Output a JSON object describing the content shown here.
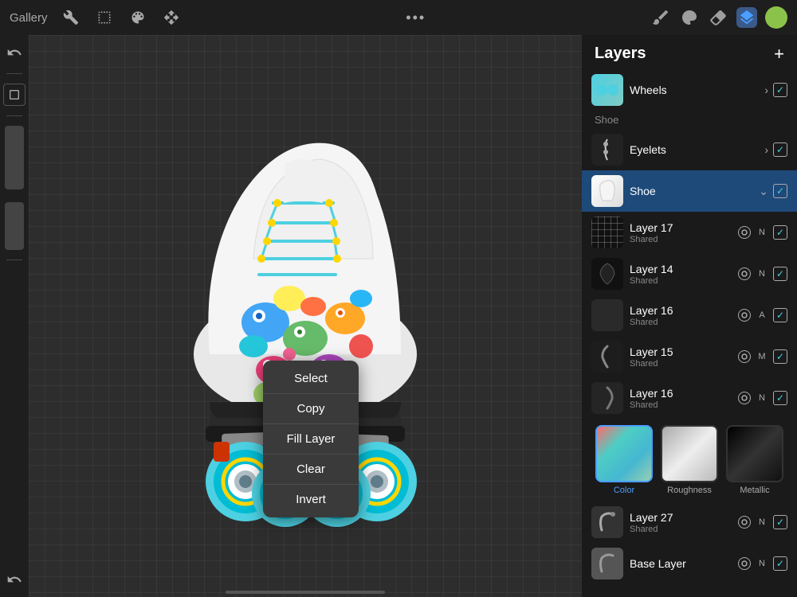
{
  "topbar": {
    "gallery_label": "Gallery",
    "center_dots": "•••",
    "tools": [
      "wrench",
      "selection",
      "stylus",
      "arrow"
    ]
  },
  "layers": {
    "title": "Layers",
    "add_label": "+",
    "items": [
      {
        "id": "wheels",
        "name": "Wheels",
        "sub": "",
        "blend": "",
        "checked": true,
        "has_chevron": true,
        "has_settings": false,
        "thumb_class": "layer-thumb-wheels"
      },
      {
        "id": "eyelets",
        "name": "Eyelets",
        "sub": "",
        "blend": "",
        "checked": true,
        "has_chevron": true,
        "has_settings": false,
        "thumb_class": "layer-thumb-eyelets"
      },
      {
        "id": "shoe",
        "name": "Shoe",
        "sub": "",
        "blend": "",
        "checked": true,
        "has_chevron": true,
        "active": true,
        "thumb_class": "layer-thumb-shoe"
      },
      {
        "id": "layer17",
        "name": "Layer 17",
        "sub": "Shared",
        "blend": "N",
        "checked": true,
        "has_chevron": false,
        "has_settings": true,
        "thumb_class": "layer-thumb-17"
      },
      {
        "id": "layer14",
        "name": "Layer 14",
        "sub": "Shared",
        "blend": "N",
        "checked": true,
        "has_chevron": false,
        "has_settings": true,
        "thumb_class": "layer-thumb-14"
      },
      {
        "id": "layer16a",
        "name": "Layer 16",
        "sub": "Shared",
        "blend": "A",
        "checked": true,
        "has_chevron": false,
        "has_settings": true,
        "thumb_class": "layer-thumb-16a"
      },
      {
        "id": "layer15",
        "name": "Layer 15",
        "sub": "Shared",
        "blend": "M",
        "checked": true,
        "has_chevron": false,
        "has_settings": true,
        "thumb_class": "layer-thumb-15"
      },
      {
        "id": "layer16b",
        "name": "Layer 16",
        "sub": "Shared",
        "blend": "N",
        "checked": true,
        "has_chevron": false,
        "has_settings": true,
        "thumb_class": "layer-thumb-16b"
      }
    ],
    "textures": [
      {
        "label": "Color",
        "selected": true
      },
      {
        "label": "Roughness",
        "selected": false
      },
      {
        "label": "Metallic",
        "selected": false
      }
    ],
    "bottom_items": [
      {
        "id": "layer27",
        "name": "Layer 27",
        "sub": "Shared",
        "blend": "N",
        "checked": true,
        "thumb_class": "layer-thumb-27"
      },
      {
        "id": "base_layer",
        "name": "Base Layer",
        "sub": "",
        "blend": "N",
        "checked": true,
        "thumb_class": "layer-thumb-base"
      }
    ]
  },
  "context_menu": {
    "items": [
      "Select",
      "Copy",
      "Fill Layer",
      "Clear",
      "Invert"
    ]
  },
  "group_label": "Shoe"
}
